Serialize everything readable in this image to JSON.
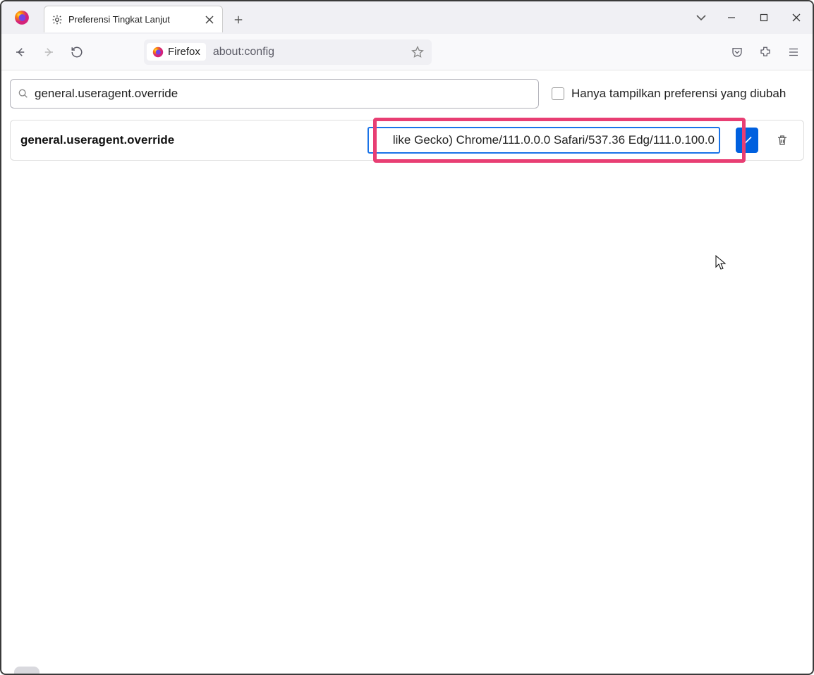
{
  "tab": {
    "title": "Preferensi Tingkat Lanjut"
  },
  "urlbar": {
    "identity_label": "Firefox",
    "url": "about:config"
  },
  "search": {
    "value": "general.useragent.override"
  },
  "checkbox": {
    "label": "Hanya tampilkan preferensi yang diubah"
  },
  "pref": {
    "name": "general.useragent.override",
    "value": "like Gecko) Chrome/111.0.0.0 Safari/537.36 Edg/111.0.100.0"
  }
}
